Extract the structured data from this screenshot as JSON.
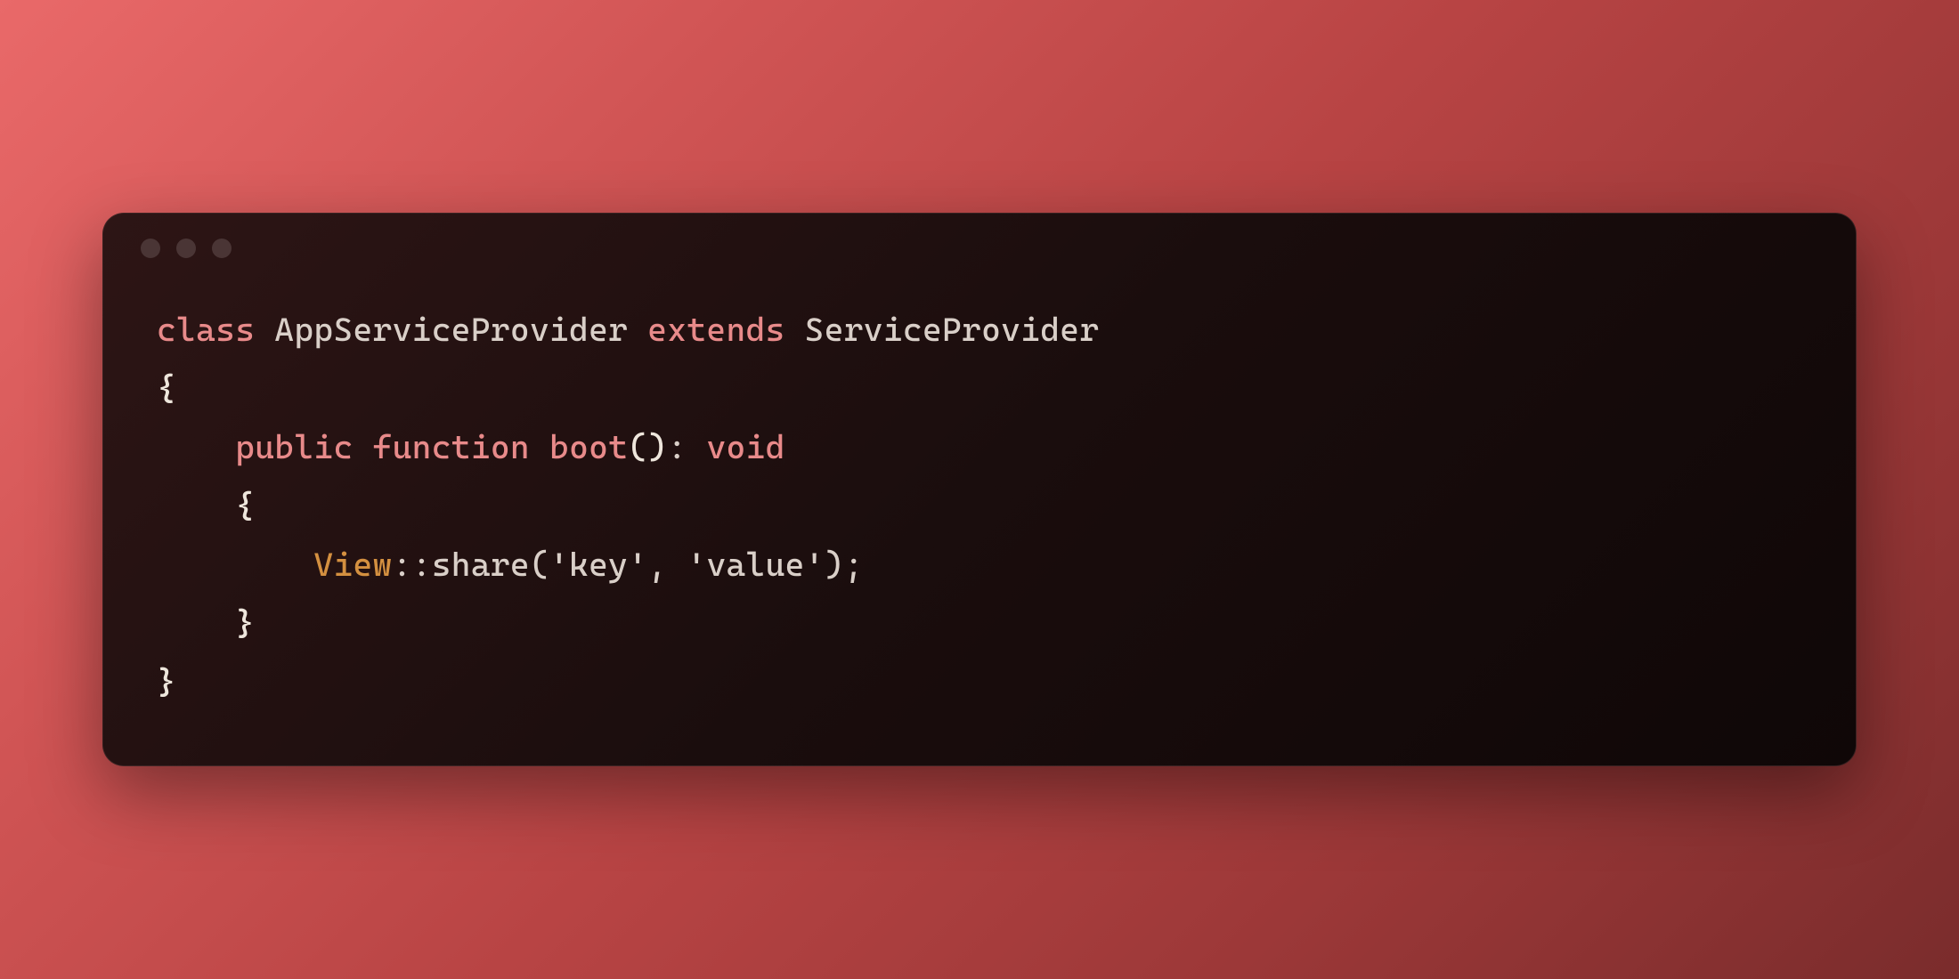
{
  "code": {
    "line1": {
      "kw_class": "class",
      "class_name": " AppServiceProvider ",
      "kw_extends": "extends",
      "parent_class": " ServiceProvider"
    },
    "line2": {
      "brace": "{"
    },
    "line3": {
      "indent": "    ",
      "kw_public": "public",
      "sp1": " ",
      "kw_function": "function",
      "sp2": " ",
      "fn_name": "boot",
      "parens": "()",
      "colon": ": ",
      "ret_type": "void"
    },
    "line4": {
      "indent": "    ",
      "brace": "{"
    },
    "line5": {
      "indent": "        ",
      "static_class": "View",
      "scope": "::",
      "method": "share",
      "open": "(",
      "str1": "'key'",
      "comma": ", ",
      "str2": "'value'",
      "close": ")",
      "semi": ";"
    },
    "line6": {
      "indent": "    ",
      "brace": "}"
    },
    "line7": {
      "brace": "}"
    }
  },
  "colors": {
    "keyword": "#e88a8a",
    "text": "#d9cfc8",
    "accent": "#d49040",
    "bg_start": "#2d1515",
    "bg_end": "#0f0707"
  }
}
